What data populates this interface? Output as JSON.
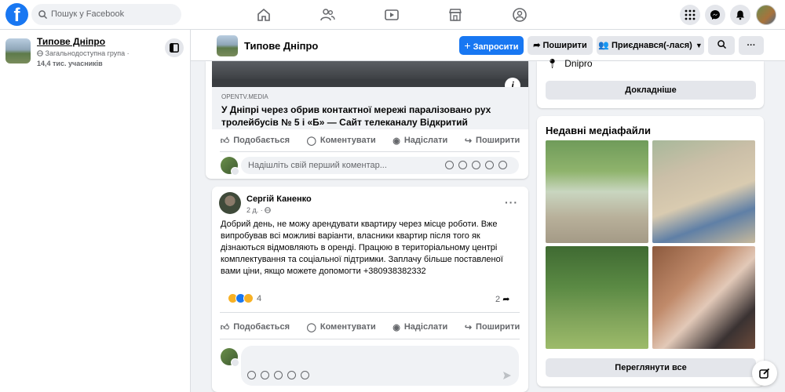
{
  "topbar": {
    "logo": "f",
    "search_placeholder": "Пошук у Facebook",
    "nav": [
      "home-icon",
      "friends-icon",
      "watch-icon",
      "marketplace-icon",
      "groups-icon"
    ],
    "right": [
      "menu-grid-icon",
      "messenger-icon",
      "notifications-icon",
      "profile-avatar"
    ]
  },
  "sidebar": {
    "group_name": "Типове Дніпро",
    "group_type": "Загальнодоступна група ·",
    "members": "14,4 тис. учасників"
  },
  "groupbar": {
    "name": "Типове Дніпро",
    "invite": "Запросити",
    "share": "Поширити",
    "joined": "Приєднався(-лася)",
    "more": "···"
  },
  "post1": {
    "link_source": "OPENTV.MEDIA",
    "link_title": "У Дніпрі через обрив контактної мережі паралізовано рух тролейбусів № 5 і «Б» — Сайт телеканалу Відкритий",
    "info": "i",
    "actions": {
      "like": "Подобається",
      "comment": "Коментувати",
      "send": "Надіслати",
      "share": "Поширити"
    },
    "comment_placeholder": "Надішліть свій перший коментар..."
  },
  "post2": {
    "author": "Сергій Каненко",
    "time": "2 д. ·",
    "text": "Добрий день, не можу арендувати квартиру через місце роботи. Вже випробував всі можливі варіанти, власники квартир після того як дізнаються відмовляють в оренді. Працюю в територіальному центрі комплектування та соціальної підтримки. Заплачу більше поставленої вами ціни, якщо можете допомогти +380938382332",
    "reactions_count": "4",
    "shares_count": "2",
    "actions": {
      "like": "Подобається",
      "comment": "Коментувати",
      "send": "Надіслати",
      "share": "Поширити"
    }
  },
  "right": {
    "location": "Dnipro",
    "learn_more": "Докладніше",
    "media_title": "Недавні медіафайли",
    "see_all": "Переглянути все"
  },
  "colors": {
    "accent": "#1877f2",
    "bg": "#f0f2f5"
  }
}
